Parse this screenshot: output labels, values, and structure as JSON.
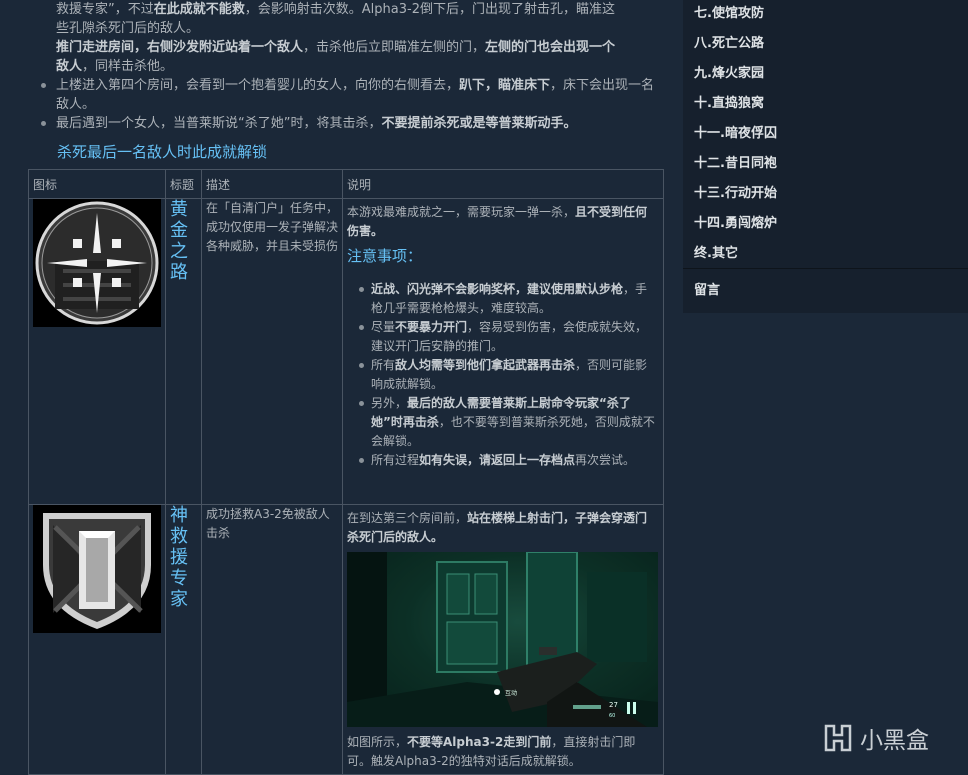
{
  "intro": {
    "line1_a": "救援专家”，不过",
    "line1_b": "在此成就不能救",
    "line1_c": "，会影响射击次数。Alpha3-2倒下后，门出现了射击孔，瞄准这",
    "line2": "些孔隙杀死门后的敌人。",
    "line3_a": "推门走进房间，右侧沙发附近站着一个敌人",
    "line3_b": "，击杀他后立即瞄准左侧的门，",
    "line3_c": "左侧的门也会出现一个",
    "line4_a": "敌人",
    "line4_b": "，同样击杀他。",
    "bullet1_a": "上楼进入第四个房间，会看到一个抱着婴儿的女人，向你的右侧看去，",
    "bullet1_b": "趴下，瞄准床下",
    "bullet1_c": "，床下会出现一名敌人。",
    "bullet2_a": "最后遇到一个女人，当普莱斯说“杀了她”时，将其击杀，",
    "bullet2_b": "不要提前杀死或是等普莱斯动手。",
    "unlock_text": "杀死最后一名敌人时此成就解锁"
  },
  "table": {
    "headers": [
      "图标",
      "标题",
      "描述",
      "说明"
    ],
    "row1": {
      "icon": "crosshair-badge-icon",
      "title": "黄金之路",
      "desc": "在「自清门户」任务中，成功仅使用一发子弹解决各种威胁，并且未受损伤",
      "note_a": "本游戏最难成就之一，需要玩家一弹一杀，",
      "note_b": "且不受到任何伤害。",
      "note_head": "注意事项：",
      "items": [
        {
          "a": "",
          "b": "近战、闪光弹不会影响奖杯，建议使用默认步枪",
          "c": "，手枪几乎需要枪枪爆头，难度较高。"
        },
        {
          "a": "尽量",
          "b": "不要暴力开门",
          "c": "，容易受到伤害，会使成就失效，建议开门后安静的推门。"
        },
        {
          "a": "所有",
          "b": "敌人均需等到他们拿起武器再击杀",
          "c": "，否则可能影响成就解锁。"
        },
        {
          "a": "另外，",
          "b": "最后的敌人需要普莱斯上尉命令玩家“杀了她”时再击杀",
          "c": "，也不要等到普莱斯杀死她，否则成就不会解锁。"
        },
        {
          "a": "所有过程",
          "b": "如有失误，请返回上一存档点",
          "c": "再次尝试。"
        }
      ]
    },
    "row2": {
      "icon": "shield-door-badge-icon",
      "title": "神救援专家",
      "desc": "成功拯救A3-2免被敌人击杀",
      "note_a": "在到达第三个房间前，",
      "note_b": "站在楼梯上射击门，子弹会穿透门杀死门后的敌人。",
      "caption_a": "如图所示，",
      "caption_b": "不要等Alpha3-2走到门前",
      "caption_c": "，直接射击门即可。触发Alpha3-2的独特对话后成就解锁。",
      "hud_ammo": "27",
      "hud_reserve": "60"
    }
  },
  "sidebar": {
    "items": [
      "七.使馆攻防",
      "八.死亡公路",
      "九.烽火家园",
      "十.直捣狼窝",
      "十一.暗夜俘囚",
      "十二.昔日同袍",
      "十三.行动开始",
      "十四.勇闯熔炉",
      "终.其它"
    ],
    "comment": "留言"
  },
  "watermark": {
    "text": "小黑盒",
    "icon": "heybox-logo-icon"
  }
}
